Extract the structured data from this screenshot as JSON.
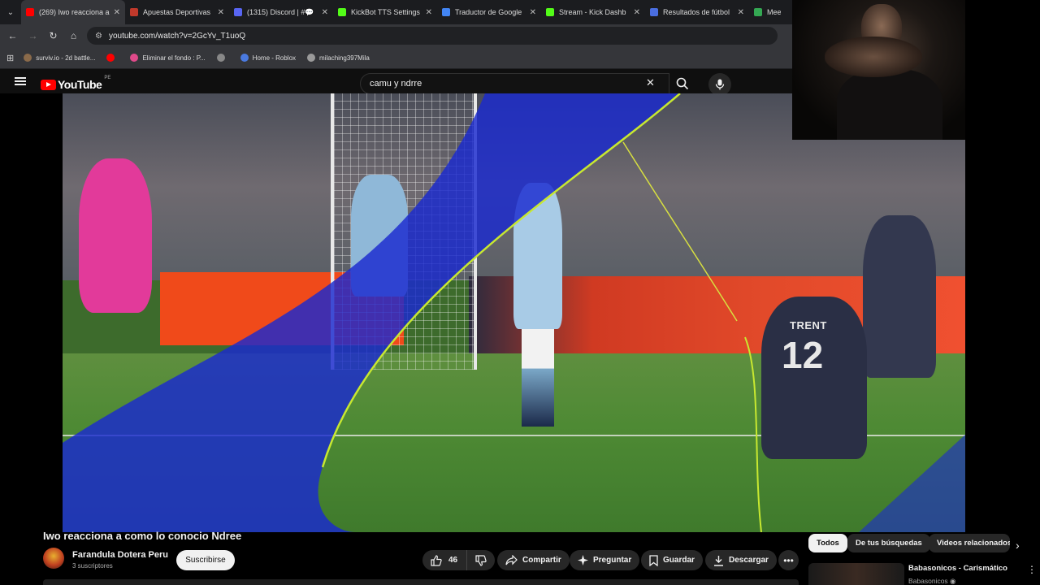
{
  "browser": {
    "tabs": [
      {
        "label": "(269) Iwo reacciona a",
        "color": "#ff0000",
        "active": true
      },
      {
        "label": "Apuestas Deportivas",
        "color": "#c0392b",
        "active": false
      },
      {
        "label": "(1315) Discord | #💬",
        "color": "#5865f2",
        "active": false
      },
      {
        "label": "KickBot TTS Settings",
        "color": "#53fc18",
        "active": false
      },
      {
        "label": "Traductor de Google",
        "color": "#4285f4",
        "active": false
      },
      {
        "label": "Stream - Kick Dashb",
        "color": "#53fc18",
        "active": false
      },
      {
        "label": "Resultados de fútbol",
        "color": "#4a6ee0",
        "active": false
      },
      {
        "label": "Meet",
        "color": "#34a853",
        "active": false
      }
    ],
    "url": "youtube.com/watch?v=2GcYv_T1uoQ",
    "bookmarks": [
      {
        "label": "surviv.io - 2d battle...",
        "color": "#8a6a4a"
      },
      {
        "label": "",
        "color": "#ff0000"
      },
      {
        "label": "Eliminar el fondo : P...",
        "color": "#e04a8a"
      },
      {
        "label": "",
        "color": "#888888"
      },
      {
        "label": "Home - Roblox",
        "color": "#4a7ae0"
      },
      {
        "label": "milaching397Mila",
        "color": "#9a9a9a"
      }
    ]
  },
  "youtube": {
    "logo_text": "YouTube",
    "country_code": "PE",
    "search_query": "camu y ndrre"
  },
  "video": {
    "jersey_name": "TRENT",
    "jersey_number": "12"
  },
  "watch": {
    "title": "Iwo reacciona a como lo conocio Ndree",
    "channel_name": "Farandula Dotera Peru",
    "subscribers": "3 suscriptores",
    "subscribe_label": "Suscribirse",
    "like_count": "46",
    "share_label": "Compartir",
    "ask_label": "Preguntar",
    "save_label": "Guardar",
    "download_label": "Descargar"
  },
  "chips": [
    {
      "label": "Todos",
      "active": true
    },
    {
      "label": "De tus búsquedas",
      "active": false
    },
    {
      "label": "Videos relacionados",
      "active": false
    }
  ],
  "recommendation": {
    "title": "Babasonicos - Carismático",
    "channel": "Babasonicos"
  }
}
